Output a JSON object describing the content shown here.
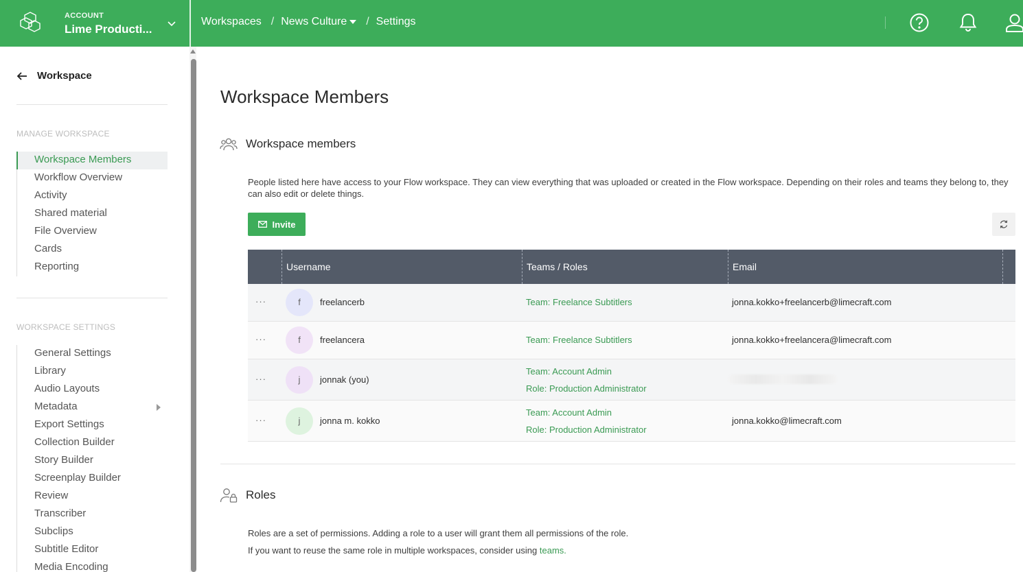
{
  "header": {
    "account_label": "ACCOUNT",
    "account_name": "Lime Producti...",
    "breadcrumb": [
      "Workspaces",
      "News Culture",
      "Settings"
    ]
  },
  "sidebar": {
    "back_label": "Workspace",
    "manage_section": "MANAGE WORKSPACE",
    "manage_items": [
      "Workspace Members",
      "Workflow Overview",
      "Activity",
      "Shared material",
      "File Overview",
      "Cards",
      "Reporting"
    ],
    "settings_section": "WORKSPACE SETTINGS",
    "settings_items": [
      "General Settings",
      "Library",
      "Audio Layouts",
      "Metadata",
      "Export Settings",
      "Collection Builder",
      "Story Builder",
      "Screenplay Builder",
      "Review",
      "Transcriber",
      "Subclips",
      "Subtitle Editor",
      "Media Encoding"
    ]
  },
  "main": {
    "title": "Workspace Members",
    "members_heading": "Workspace members",
    "members_desc": "People listed here have access to your Flow workspace. They can view everything that was uploaded or created in the Flow workspace. Depending on their roles and teams they belong to, they can also edit or delete things.",
    "invite_label": "Invite",
    "table": {
      "columns": [
        "Username",
        "Teams / Roles",
        "Email"
      ],
      "rows": [
        {
          "initial": "f",
          "username": "freelancerb",
          "teams": [
            "Team: Freelance Subtitlers"
          ],
          "email": "jonna.kokko+freelancerb@limecraft.com"
        },
        {
          "initial": "f",
          "username": "freelancera",
          "teams": [
            "Team: Freelance Subtitlers"
          ],
          "email": "jonna.kokko+freelancera@limecraft.com"
        },
        {
          "initial": "j",
          "username": "jonnak (you)",
          "teams": [
            "Team: Account Admin",
            "Role: Production Administrator"
          ],
          "email": ""
        },
        {
          "initial": "j",
          "username": "jonna m. kokko",
          "teams": [
            "Team: Account Admin",
            "Role: Production Administrator"
          ],
          "email": "jonna.kokko@limecraft.com"
        }
      ]
    },
    "roles_heading": "Roles",
    "roles_desc_1": "Roles are a set of permissions. Adding a role to a user will grant them all permissions of the role.",
    "roles_desc_2": "If you want to reuse the same role in multiple workspaces, consider using",
    "roles_link": "teams."
  },
  "colors": {
    "brand_green": "#3dad5a",
    "table_header": "#535b68",
    "link_green": "#3a9a53"
  },
  "icons": [
    "app-logo-icon",
    "chevron-down-icon",
    "help-icon",
    "bell-icon",
    "user-icon",
    "arrow-left-icon",
    "users-icon",
    "mail-icon",
    "refresh-icon",
    "user-lock-icon"
  ]
}
